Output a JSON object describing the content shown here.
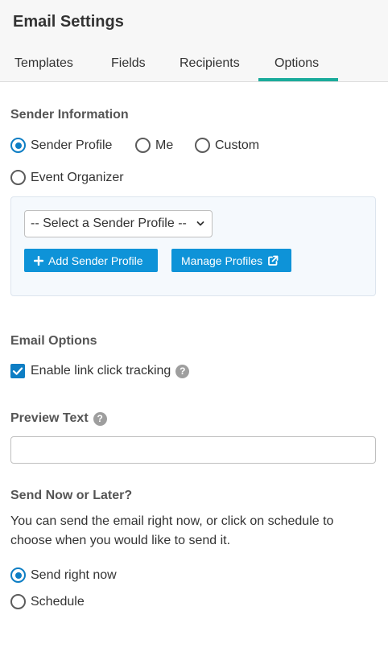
{
  "header": {
    "title": "Email Settings",
    "tabs": [
      {
        "label": "Templates",
        "active": false
      },
      {
        "label": "Fields",
        "active": false
      },
      {
        "label": "Recipients",
        "active": false
      },
      {
        "label": "Options",
        "active": true
      }
    ]
  },
  "sender": {
    "section_title": "Sender Information",
    "options": [
      {
        "label": "Sender Profile",
        "selected": true
      },
      {
        "label": "Me",
        "selected": false
      },
      {
        "label": "Custom",
        "selected": false
      },
      {
        "label": "Event Organizer",
        "selected": false
      }
    ],
    "select_value": "-- Select a Sender Profile --",
    "add_button_label": "Add Sender Profile",
    "manage_button_label": "Manage Profiles"
  },
  "email_options": {
    "section_title": "Email Options",
    "link_tracking_label": "Enable link click tracking",
    "link_tracking_checked": true
  },
  "preview_text": {
    "label": "Preview Text",
    "value": ""
  },
  "send_timing": {
    "section_title": "Send Now or Later?",
    "description": "You can send the email right now, or click on schedule to choose when you would like to send it.",
    "options": [
      {
        "label": "Send right now",
        "selected": true
      },
      {
        "label": "Schedule",
        "selected": false
      }
    ]
  },
  "colors": {
    "accent_teal": "#1aab9b",
    "primary_blue": "#0e93d8",
    "radio_blue": "#0e7ec4"
  },
  "icons": {
    "help": "question-circle-icon",
    "add": "plus-icon",
    "external": "external-link-icon",
    "dropdown": "chevron-down-icon"
  }
}
